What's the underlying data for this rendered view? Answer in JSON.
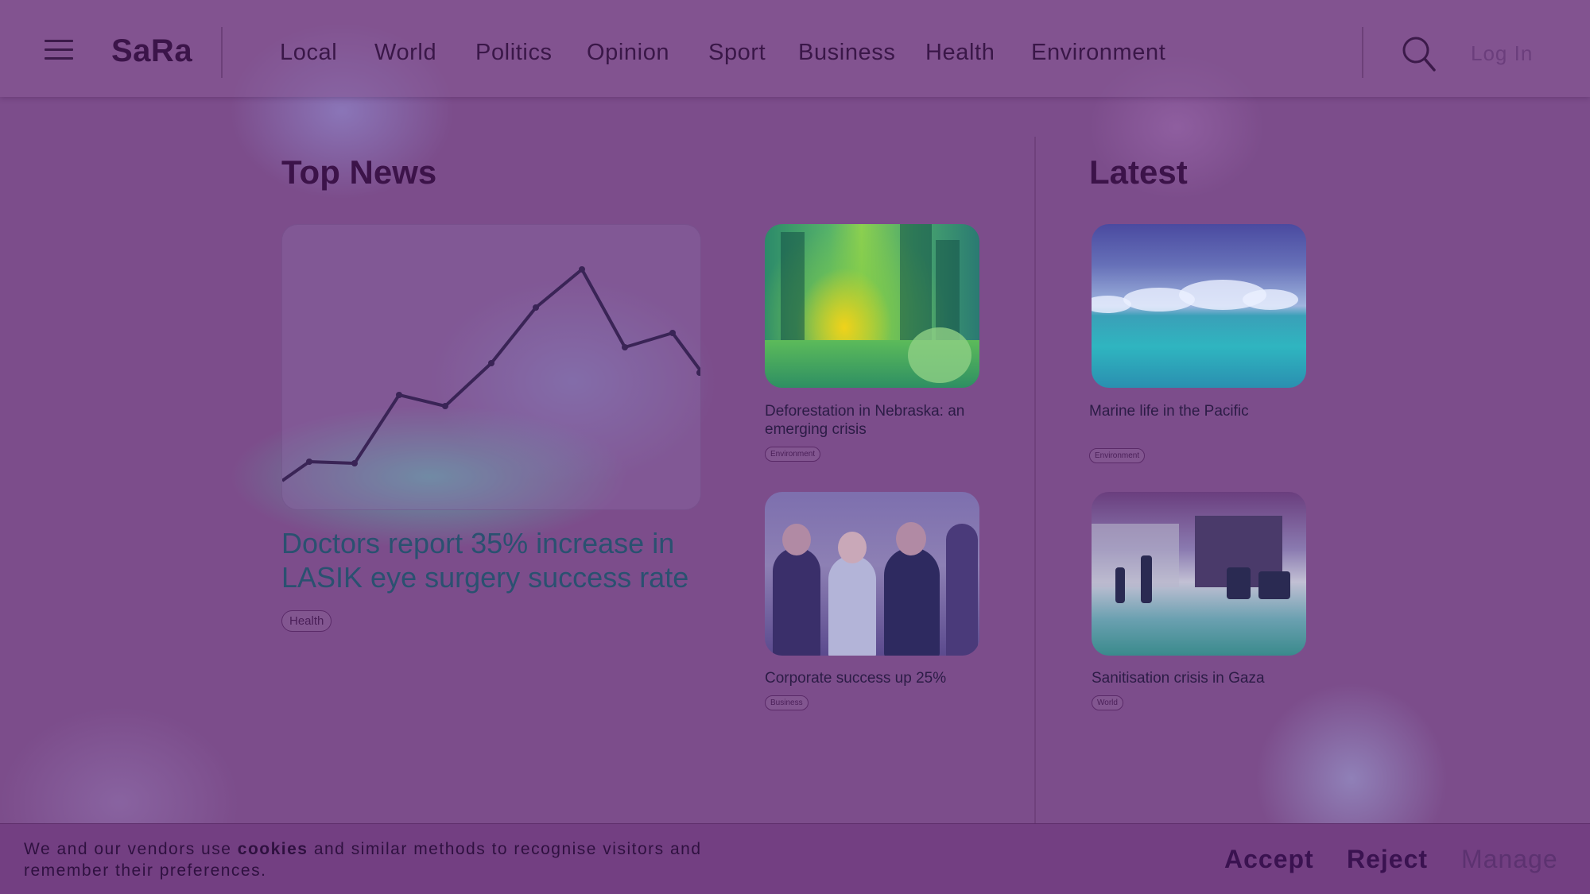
{
  "header": {
    "logo": "SaRa",
    "nav": [
      "Local",
      "World",
      "Politics",
      "Opinion",
      "Sport",
      "Business",
      "Health",
      "Environment"
    ],
    "login": "Log In"
  },
  "top_news": {
    "title": "Top News",
    "headline": "Doctors report 35% increase in LASIK eye surgery success rate",
    "tag": "Health",
    "cards": [
      {
        "title": "Deforestation in Nebraska: an emerging crisis",
        "tag": "Environment",
        "image": "forest"
      },
      {
        "title": "Corporate success up 25%",
        "tag": "Business",
        "image": "celebrating-team"
      }
    ]
  },
  "latest": {
    "title": "Latest",
    "cards": [
      {
        "title": "Marine life in the Pacific",
        "tag": "Environment",
        "image": "ocean"
      },
      {
        "title": "Sanitisation crisis in Gaza",
        "tag": "World",
        "image": "flooded-street"
      }
    ]
  },
  "cookie": {
    "text_before": "We and our vendors use ",
    "text_bold": "cookies",
    "text_after": " and similar methods to recognise visitors and remember their preferences.",
    "accept": "Accept",
    "reject": "Reject",
    "manage": "Manage"
  },
  "colors": {
    "background": "#7c4d8b",
    "header": "#8b5a98",
    "text_dark": "#3a1748",
    "headline": "#2a5170",
    "cookie_bar": "#733f82"
  },
  "icons": [
    "hamburger-menu-icon",
    "search-icon"
  ]
}
